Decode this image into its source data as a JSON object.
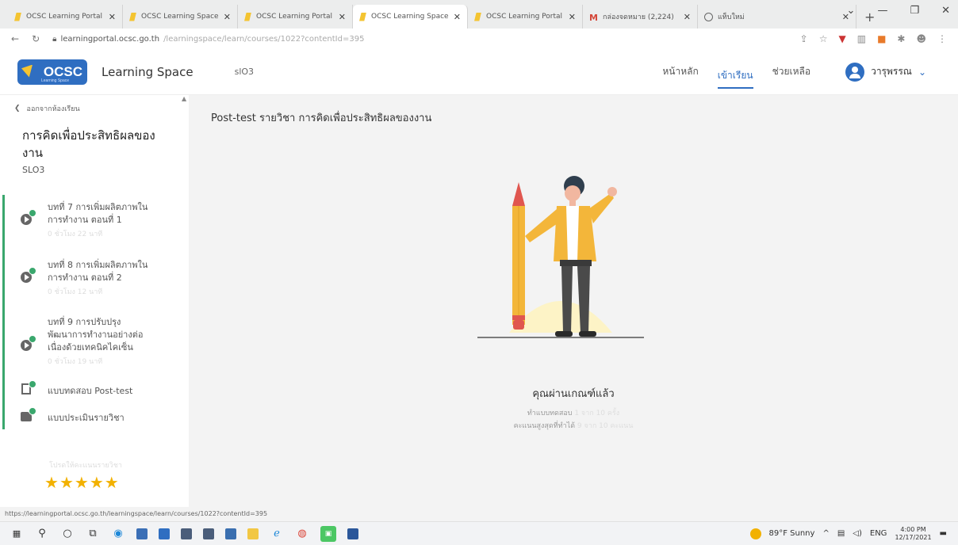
{
  "browser": {
    "tabs": [
      {
        "title": "OCSC Learning Portal",
        "icon": "ocsc-favicon",
        "active": false
      },
      {
        "title": "OCSC Learning Space",
        "icon": "ocsc-favicon",
        "active": false
      },
      {
        "title": "OCSC Learning Portal",
        "icon": "ocsc-favicon",
        "active": false
      },
      {
        "title": "OCSC Learning Space",
        "icon": "ocsc-favicon",
        "active": true
      },
      {
        "title": "OCSC Learning Portal",
        "icon": "ocsc-favicon",
        "active": false
      },
      {
        "title": "กล่องจดหมาย (2,224)",
        "icon": "gmail-icon",
        "active": false
      },
      {
        "title": "แท็บใหม่",
        "icon": "globe-icon",
        "active": false
      }
    ],
    "url_host": "learningportal.ocsc.go.th",
    "url_path": "/learningspace/learn/courses/1022?contentId=395",
    "status_url": "https://learningportal.ocsc.go.th/learningspace/learn/courses/1022?contentId=395"
  },
  "header": {
    "logo_text": "OCSC",
    "logo_sub": "Learning Space",
    "site_title": "Learning Space",
    "course_code": "slO3",
    "nav": [
      "หน้าหลัก",
      "เข้าเรียน",
      "ช่วยเหลือ"
    ],
    "active_nav": 1,
    "user_name": "วารุพรรณ"
  },
  "sidebar": {
    "back_label": "ออกจากห้องเรียน",
    "course_title": "การคิดเพื่อประสิทธิผลของงาน",
    "course_code": "SLO3",
    "lessons": [
      {
        "title": "บทที่ 7 การเพิ่มผลิตภาพในการทำงาน ตอนที่ 1",
        "duration": "0 ชั่วโมง 22 นาที",
        "icon": "play-icon"
      },
      {
        "title": "บทที่ 8 การเพิ่มผลิตภาพในการทำงาน ตอนที่ 2",
        "duration": "0 ชั่วโมง 12 นาที",
        "icon": "play-icon"
      },
      {
        "title": "บทที่ 9 การปรับปรุงพัฒนาการทำงานอย่างต่อเนื่องด้วยเทคนิคไคเซ็น",
        "duration": "0 ชั่วโมง 19 นาที",
        "icon": "play-icon"
      },
      {
        "title": "แบบทดสอบ Post-test",
        "duration": "",
        "icon": "document-icon"
      },
      {
        "title": "แบบประเมินรายวิชา",
        "duration": "",
        "icon": "thumbs-up-icon"
      }
    ],
    "rating_label": "โปรดให้คะแนนรายวิชา",
    "rating": {
      "value": 5,
      "max": 5
    }
  },
  "main": {
    "title": "Post-test รายวิชา การคิดเพื่อประสิทธิผลของงาน",
    "result_title": "คุณผ่านเกณฑ์แล้ว",
    "attempts_label": "ทำแบบทดสอบ",
    "attempts_value": "1 จาก 10 ครั้ง",
    "best_label": "คะแนนสูงสุดที่ทำได้",
    "best_value": "9 จาก 10 คะแนน"
  },
  "taskbar": {
    "weather": "89°F Sunny",
    "lang": "ENG",
    "time": "4:00 PM",
    "date": "12/17/2021"
  },
  "colors": {
    "accent": "#2f6ec1",
    "success": "#3aa76d",
    "star": "#f2b100"
  }
}
